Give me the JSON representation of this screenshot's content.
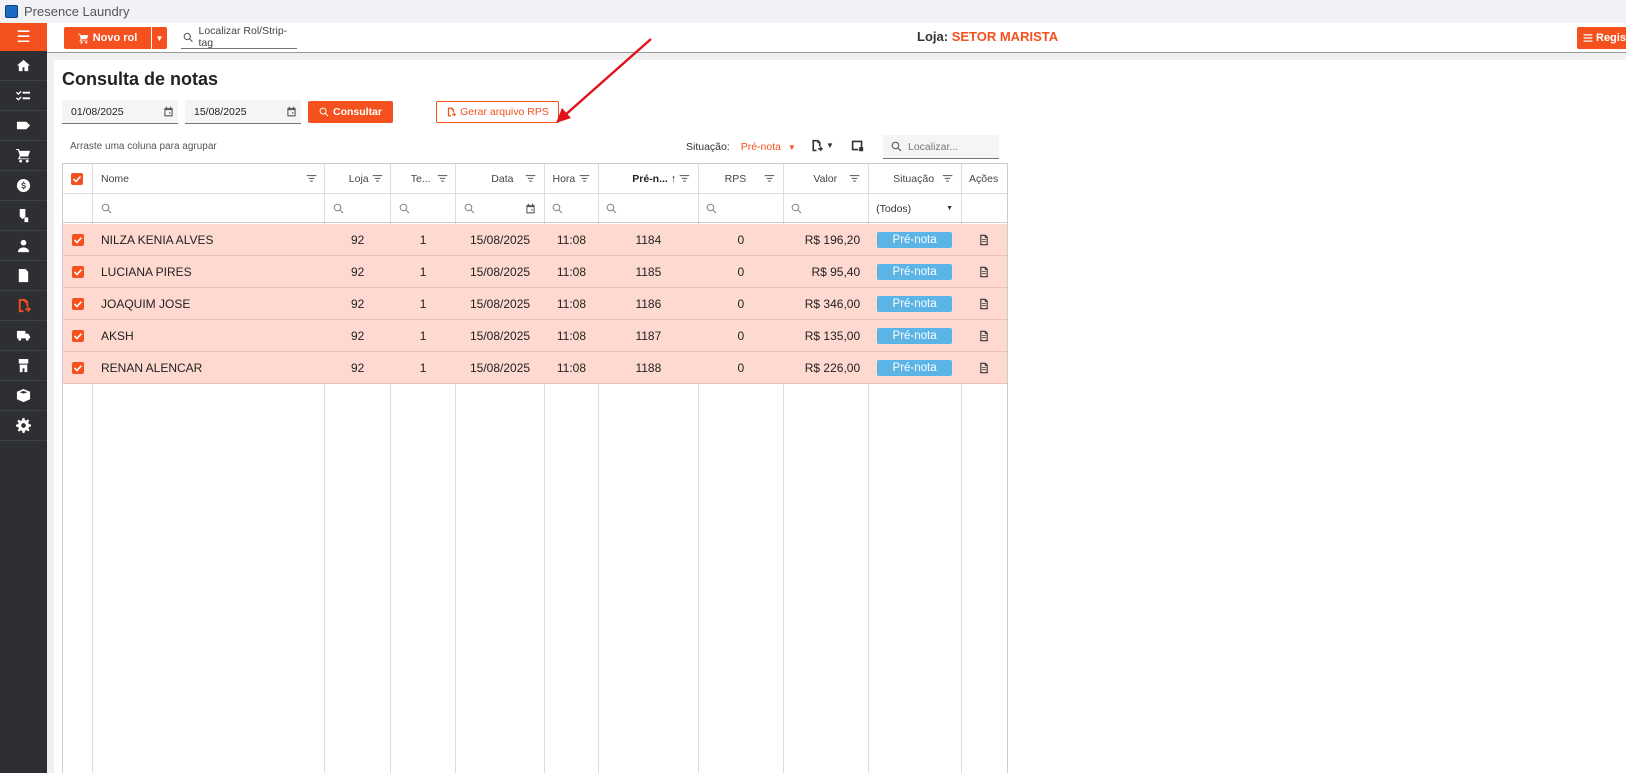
{
  "app": {
    "title": "Presence Laundry"
  },
  "sidebar": {
    "items": [
      {
        "icon": "home-icon"
      },
      {
        "icon": "checklist-icon"
      },
      {
        "icon": "tag-icon"
      },
      {
        "icon": "cart-icon"
      },
      {
        "icon": "dollar-icon"
      },
      {
        "icon": "tag-scan-icon"
      },
      {
        "icon": "person-icon"
      },
      {
        "icon": "document-icon"
      },
      {
        "icon": "document-export-icon"
      },
      {
        "icon": "truck-icon"
      },
      {
        "icon": "hanger-icon"
      },
      {
        "icon": "box-icon"
      },
      {
        "icon": "gear-icon"
      }
    ],
    "active_index": 8
  },
  "topbar": {
    "novo_label": "Novo rol",
    "search_placeholder": "Localizar Rol/Strip-tag",
    "loja_label": "Loja:",
    "loja_value": "SETOR MARISTA",
    "regis_label": "Regis"
  },
  "page": {
    "title": "Consulta de notas",
    "date_from": "01/08/2025",
    "date_to": "15/08/2025",
    "consultar_label": "Consultar",
    "gerar_label": "Gerar arquivo RPS",
    "group_hint": "Arraste uma coluna para agrupar",
    "situacao_label": "Situação:",
    "situacao_value": "Pré-nota",
    "grid_search_placeholder": "Localizar..."
  },
  "grid": {
    "columns": [
      "Nome",
      "Loja",
      "Te...",
      "Data",
      "Hora",
      "Pré-n...",
      "RPS",
      "Valor",
      "Situação",
      "Ações"
    ],
    "situacao_filter": "(Todos)",
    "rows": [
      {
        "nome": "NILZA KENIA ALVES",
        "loja": "92",
        "te": "1",
        "data": "15/08/2025",
        "hora": "11:08",
        "pre": "1184",
        "rps": "0",
        "valor": "R$ 196,20",
        "situacao": "Pré-nota"
      },
      {
        "nome": "LUCIANA PIRES",
        "loja": "92",
        "te": "1",
        "data": "15/08/2025",
        "hora": "11:08",
        "pre": "1185",
        "rps": "0",
        "valor": "R$ 95,40",
        "situacao": "Pré-nota"
      },
      {
        "nome": "JOAQUIM JOSE",
        "loja": "92",
        "te": "1",
        "data": "15/08/2025",
        "hora": "11:08",
        "pre": "1186",
        "rps": "0",
        "valor": "R$ 346,00",
        "situacao": "Pré-nota"
      },
      {
        "nome": "AKSH",
        "loja": "92",
        "te": "1",
        "data": "15/08/2025",
        "hora": "11:08",
        "pre": "1187",
        "rps": "0",
        "valor": "R$ 135,00",
        "situacao": "Pré-nota"
      },
      {
        "nome": "RENAN ALENCAR",
        "loja": "92",
        "te": "1",
        "data": "15/08/2025",
        "hora": "11:08",
        "pre": "1188",
        "rps": "0",
        "valor": "R$ 226,00",
        "situacao": "Pré-nota"
      }
    ]
  },
  "colors": {
    "accent": "#f4511e",
    "badge": "#5ab4e5",
    "row_selected": "#fdd9cf",
    "sidebar": "#2d2f33"
  }
}
